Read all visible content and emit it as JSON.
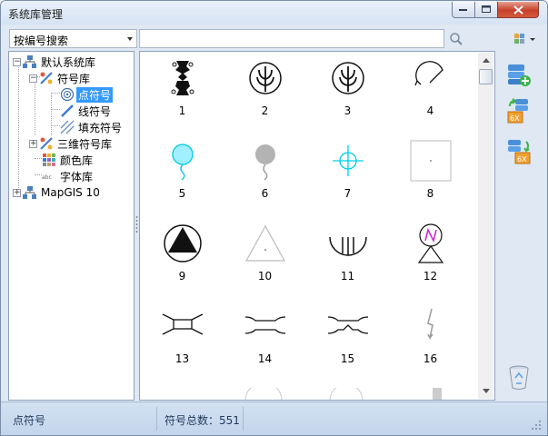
{
  "window": {
    "title": "系统库管理"
  },
  "toolbar": {
    "search_mode": "按编号搜索",
    "search_placeholder": "",
    "search_icon": "magnifier-icon",
    "view_icon": "view-grid-dropdown-icon"
  },
  "tree": {
    "root1": "默认系统库",
    "symbol_lib": "符号库",
    "point_symbol": "点符号",
    "line_symbol": "线符号",
    "fill_symbol": "填充符号",
    "symbol3d_lib": "三维符号库",
    "color_lib": "颜色库",
    "font_lib": "字体库",
    "root2": "MapGIS 10"
  },
  "symbols": [
    {
      "num": "1",
      "icon": "ornament-figure-icon"
    },
    {
      "num": "2",
      "icon": "circle-tree-icon"
    },
    {
      "num": "3",
      "icon": "circle-tree-icon"
    },
    {
      "num": "4",
      "icon": "arc-arrow-icon"
    },
    {
      "num": "5",
      "icon": "cyan-balloon-icon"
    },
    {
      "num": "6",
      "icon": "gray-balloon-icon"
    },
    {
      "num": "7",
      "icon": "crosshair-icon"
    },
    {
      "num": "8",
      "icon": "square-dot-icon"
    },
    {
      "num": "9",
      "icon": "circle-triangle-icon"
    },
    {
      "num": "10",
      "icon": "triangle-outline-icon"
    },
    {
      "num": "11",
      "icon": "semicircle-lines-icon"
    },
    {
      "num": "12",
      "icon": "n-beacon-icon"
    },
    {
      "num": "13",
      "icon": "bridge-rect-icon"
    },
    {
      "num": "14",
      "icon": "bridge-curve-icon"
    },
    {
      "num": "15",
      "icon": "bridge-notch-icon"
    },
    {
      "num": "16",
      "icon": "lightning-arrow-icon"
    }
  ],
  "actions": {
    "add_icon": "add-library-icon",
    "export_icon": "export-6x-icon",
    "import_icon": "import-6x-icon",
    "delete_icon": "recycle-bin-icon"
  },
  "status": {
    "current": "点符号",
    "total_label": "符号总数：551"
  }
}
